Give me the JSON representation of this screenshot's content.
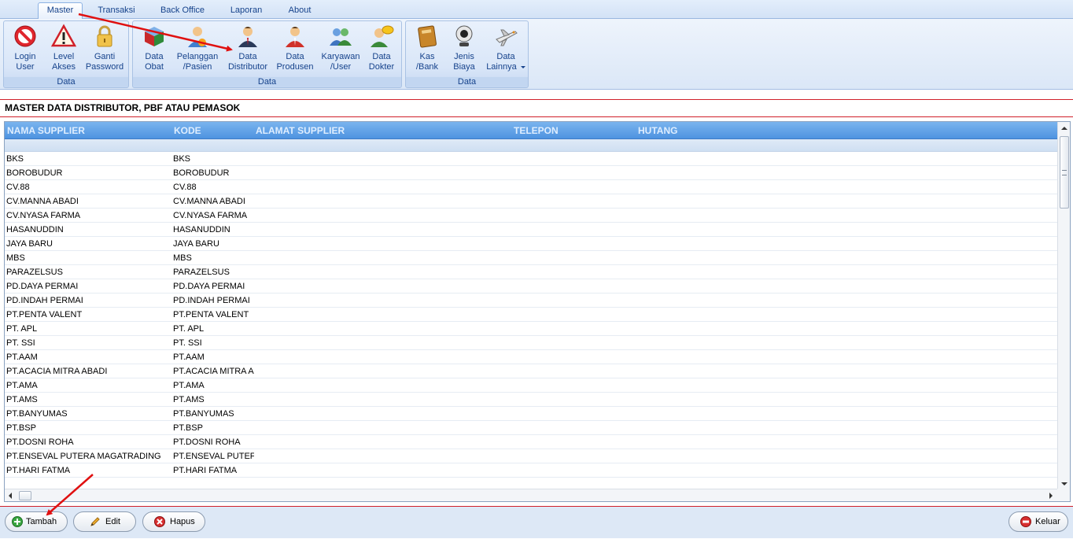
{
  "tabs": [
    {
      "label": "Master",
      "active": true
    },
    {
      "label": "Transaksi",
      "active": false
    },
    {
      "label": "Back Office",
      "active": false
    },
    {
      "label": "Laporan",
      "active": false
    },
    {
      "label": "About",
      "active": false
    }
  ],
  "ribbon": {
    "group1": {
      "label": "Data",
      "buttons": [
        {
          "l1": "Login",
          "l2": "User",
          "icon": "no-entry-icon"
        },
        {
          "l1": "Level",
          "l2": "Akses",
          "icon": "warning-icon"
        },
        {
          "l1": "Ganti",
          "l2": "Password",
          "icon": "padlock-icon"
        }
      ]
    },
    "group2": {
      "label": "Data",
      "buttons": [
        {
          "l1": "Data",
          "l2": "Obat",
          "icon": "medicine-box-icon"
        },
        {
          "l1": "Pelanggan",
          "l2": "/Pasien",
          "icon": "customer-icon"
        },
        {
          "l1": "Data",
          "l2": "Distributor",
          "icon": "distributor-person-icon"
        },
        {
          "l1": "Data",
          "l2": "Produsen",
          "icon": "producer-person-icon"
        },
        {
          "l1": "Karyawan",
          "l2": "/User",
          "icon": "employees-icon"
        },
        {
          "l1": "Data",
          "l2": "Dokter",
          "icon": "doctor-icon"
        }
      ]
    },
    "group3": {
      "label": "Data",
      "buttons": [
        {
          "l1": "Kas",
          "l2": "/Bank",
          "icon": "cash-book-icon"
        },
        {
          "l1": "Jenis",
          "l2": "Biaya",
          "icon": "webcam-icon"
        },
        {
          "l1": "Data",
          "l2": "Lainnya",
          "icon": "airplane-icon",
          "dropdown": true
        }
      ]
    }
  },
  "page": {
    "title": "MASTER DATA DISTRIBUTOR, PBF ATAU PEMASOK"
  },
  "grid": {
    "columns": [
      "NAMA SUPPLIER",
      "KODE",
      "ALAMAT SUPPLIER",
      "TELEPON",
      "HUTANG"
    ],
    "rows": [
      {
        "nama": "BKS",
        "kode": "BKS"
      },
      {
        "nama": "BOROBUDUR",
        "kode": "BOROBUDUR"
      },
      {
        "nama": "CV.88",
        "kode": "CV.88"
      },
      {
        "nama": "CV.MANNA ABADI",
        "kode": "CV.MANNA ABADI"
      },
      {
        "nama": "CV.NYASA FARMA",
        "kode": "CV.NYASA FARMA"
      },
      {
        "nama": "HASANUDDIN",
        "kode": "HASANUDDIN"
      },
      {
        "nama": "JAYA BARU",
        "kode": "JAYA BARU"
      },
      {
        "nama": "MBS",
        "kode": "MBS"
      },
      {
        "nama": "PARAZELSUS",
        "kode": "PARAZELSUS"
      },
      {
        "nama": "PD.DAYA PERMAI",
        "kode": "PD.DAYA PERMAI"
      },
      {
        "nama": "PD.INDAH PERMAI",
        "kode": "PD.INDAH PERMAI"
      },
      {
        "nama": "PT.PENTA VALENT",
        "kode": "PT.PENTA VALENT"
      },
      {
        "nama": "PT. APL",
        "kode": "PT. APL"
      },
      {
        "nama": "PT. SSI",
        "kode": "PT. SSI"
      },
      {
        "nama": "PT.AAM",
        "kode": "PT.AAM"
      },
      {
        "nama": "PT.ACACIA MITRA ABADI",
        "kode": "PT.ACACIA MITRA A"
      },
      {
        "nama": "PT.AMA",
        "kode": "PT.AMA"
      },
      {
        "nama": "PT.AMS",
        "kode": "PT.AMS"
      },
      {
        "nama": "PT.BANYUMAS",
        "kode": "PT.BANYUMAS"
      },
      {
        "nama": "PT.BSP",
        "kode": "PT.BSP"
      },
      {
        "nama": "PT.DOSNI ROHA",
        "kode": "PT.DOSNI ROHA"
      },
      {
        "nama": "PT.ENSEVAL PUTERA MAGATRADING",
        "kode": "PT.ENSEVAL PUTEF"
      },
      {
        "nama": "PT.HARI FATMA",
        "kode": "PT.HARI FATMA"
      }
    ]
  },
  "buttons": {
    "tambah": "Tambah",
    "edit": "Edit",
    "hapus": "Hapus",
    "keluar": "Keluar"
  },
  "colors": {
    "header_blue": "#4e93e0",
    "accent_red": "#d0202a",
    "ribbon_text": "#15428b"
  }
}
